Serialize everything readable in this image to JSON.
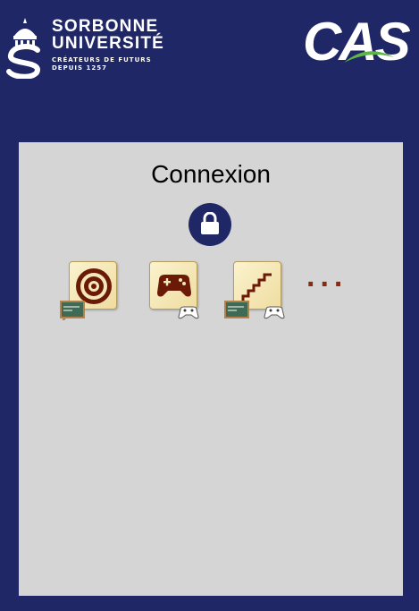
{
  "header": {
    "university": {
      "line1": "SORBONNE",
      "line2": "UNIVERSITÉ",
      "tagline1": "CRÉATEURS DE FUTURS",
      "tagline2": "DEPUIS 1257"
    },
    "cas_logo_text": "CAS"
  },
  "login": {
    "title": "Connexion",
    "lock_icon": "lock-icon",
    "methods": [
      {
        "icon": "target-icon",
        "badges": [
          "chalkboard-icon"
        ]
      },
      {
        "icon": "gamepad-icon",
        "badges": [
          "controller-icon"
        ]
      },
      {
        "icon": "staircase-icon",
        "badges": [
          "chalkboard-icon",
          "controller-icon"
        ]
      }
    ],
    "more": "..."
  },
  "colors": {
    "background": "#1f2766",
    "panel": "#d5d5d5",
    "tile_icon": "#6b1a08",
    "cas_swoosh": "#5fb548"
  }
}
